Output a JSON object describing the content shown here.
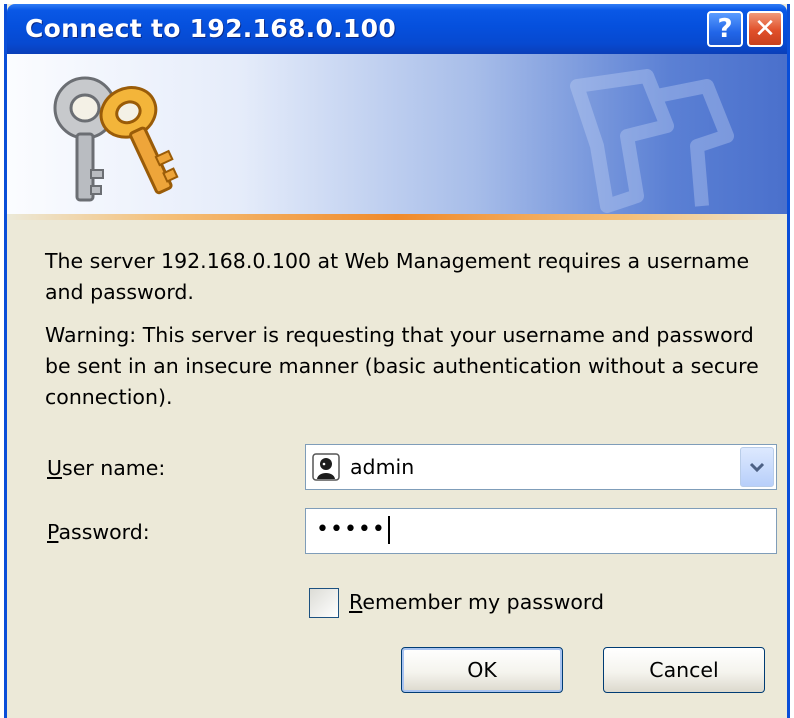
{
  "window": {
    "title": "Connect to 192.168.0.100",
    "help_label": "?",
    "close_label": "✕"
  },
  "message": {
    "line1": "The server 192.168.0.100 at Web Management requires a username and password.",
    "warning": "Warning: This server is requesting that your username and password be sent in an insecure manner (basic authentication without a secure connection)."
  },
  "form": {
    "username_label_hotkey": "U",
    "username_label_rest": "ser name:",
    "username_value": "admin",
    "password_label_hotkey": "P",
    "password_label_rest": "assword:",
    "password_value": "•••••",
    "remember_hotkey": "R",
    "remember_rest": "emember my password",
    "remember_checked": false
  },
  "buttons": {
    "ok": "OK",
    "cancel": "Cancel"
  },
  "colors": {
    "titlebar": "#0550dd",
    "dialog_bg": "#ece9d8",
    "banner_accent": "#f08a2a",
    "close_button": "#e0502a"
  },
  "icons": {
    "banner": "keys-icon",
    "user": "user-icon",
    "dropdown": "chevron-down-icon"
  }
}
